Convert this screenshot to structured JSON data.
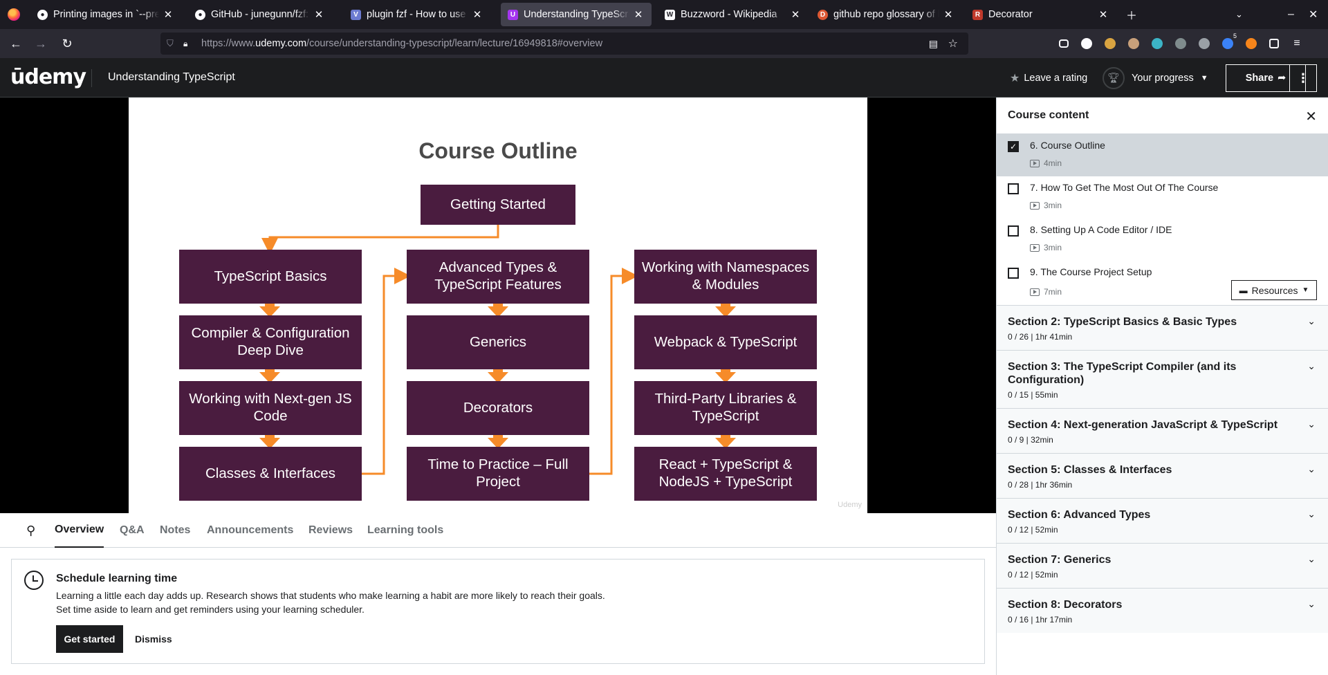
{
  "browser": {
    "tabs": [
      {
        "title": "Printing images in `--preview`",
        "favicon_color": "#2b2a33",
        "favicon_glyph": "github-icon"
      },
      {
        "title": "GitHub - junegunn/fzf: A command-line fuzzy finder",
        "favicon_color": "#2b2a33",
        "favicon_glyph": "github-icon"
      },
      {
        "title": "plugin fzf - How to use FZF to",
        "favicon_color": "#6c7bd1",
        "favicon_glyph": "V"
      },
      {
        "title": "Understanding TypeScript | Udemy",
        "favicon_color": "#a435f0",
        "favicon_glyph": "U"
      },
      {
        "title": "Buzzword - Wikipedia",
        "favicon_color": "#ffffff",
        "favicon_glyph": "W"
      },
      {
        "title": "github repo glossary of buzzwords",
        "favicon_color": "#de5833",
        "favicon_glyph": "D"
      },
      {
        "title": "Decorator",
        "favicon_color": "#c0392b",
        "favicon_glyph": "R"
      }
    ],
    "url_prefix": "https://www.",
    "url_host": "udemy.com",
    "url_path": "/course/understanding-typescript/learn/lecture/16949818#overview",
    "ext_badge": "5"
  },
  "header": {
    "logo": "ūdemy",
    "course_title": "Understanding TypeScript",
    "rating_label": "Leave a rating",
    "progress_label": "Your progress",
    "share_label": "Share"
  },
  "slide": {
    "title": "Course Outline",
    "top_box": "Getting Started",
    "col1": [
      "TypeScript Basics",
      "Compiler & Configuration Deep Dive",
      "Working with Next-gen JS Code",
      "Classes & Interfaces"
    ],
    "col2": [
      "Advanced Types & TypeScript Features",
      "Generics",
      "Decorators",
      "Time to Practice – Full Project"
    ],
    "col3": [
      "Working with Namespaces & Modules",
      "Webpack & TypeScript",
      "Third-Party Libraries & TypeScript",
      "React + TypeScript & NodeJS + TypeScript"
    ],
    "watermark": "Udemy",
    "box_color": "#4a1c3f",
    "arrow_color": "#f68b29"
  },
  "lecture_tabs": [
    "Overview",
    "Q&A",
    "Notes",
    "Announcements",
    "Reviews",
    "Learning tools"
  ],
  "schedule": {
    "title": "Schedule learning time",
    "line1": "Learning a little each day adds up. Research shows that students who make learning a habit are more likely to reach their goals.",
    "line2": "Set time aside to learn and get reminders using your learning scheduler.",
    "primary": "Get started",
    "secondary": "Dismiss"
  },
  "sidebar": {
    "title": "Course content",
    "lectures": [
      {
        "title": "6. Course Outline",
        "duration": "4min",
        "checked": true
      },
      {
        "title": "7. How To Get The Most Out Of The Course",
        "duration": "3min",
        "checked": false
      },
      {
        "title": "8. Setting Up A Code Editor / IDE",
        "duration": "3min",
        "checked": false
      },
      {
        "title": "9. The Course Project Setup",
        "duration": "7min",
        "checked": false
      }
    ],
    "resources_label": "Resources",
    "sections": [
      {
        "title": "Section 2: TypeScript Basics & Basic Types",
        "meta": "0 / 26 | 1hr 41min"
      },
      {
        "title": "Section 3: The TypeScript Compiler (and its Configuration)",
        "meta": "0 / 15 | 55min"
      },
      {
        "title": "Section 4: Next-generation JavaScript & TypeScript",
        "meta": "0 / 9 | 32min"
      },
      {
        "title": "Section 5: Classes & Interfaces",
        "meta": "0 / 28 | 1hr 36min"
      },
      {
        "title": "Section 6: Advanced Types",
        "meta": "0 / 12 | 52min"
      },
      {
        "title": "Section 7: Generics",
        "meta": "0 / 12 | 52min"
      },
      {
        "title": "Section 8: Decorators",
        "meta": "0 / 16 | 1hr 17min"
      }
    ]
  }
}
